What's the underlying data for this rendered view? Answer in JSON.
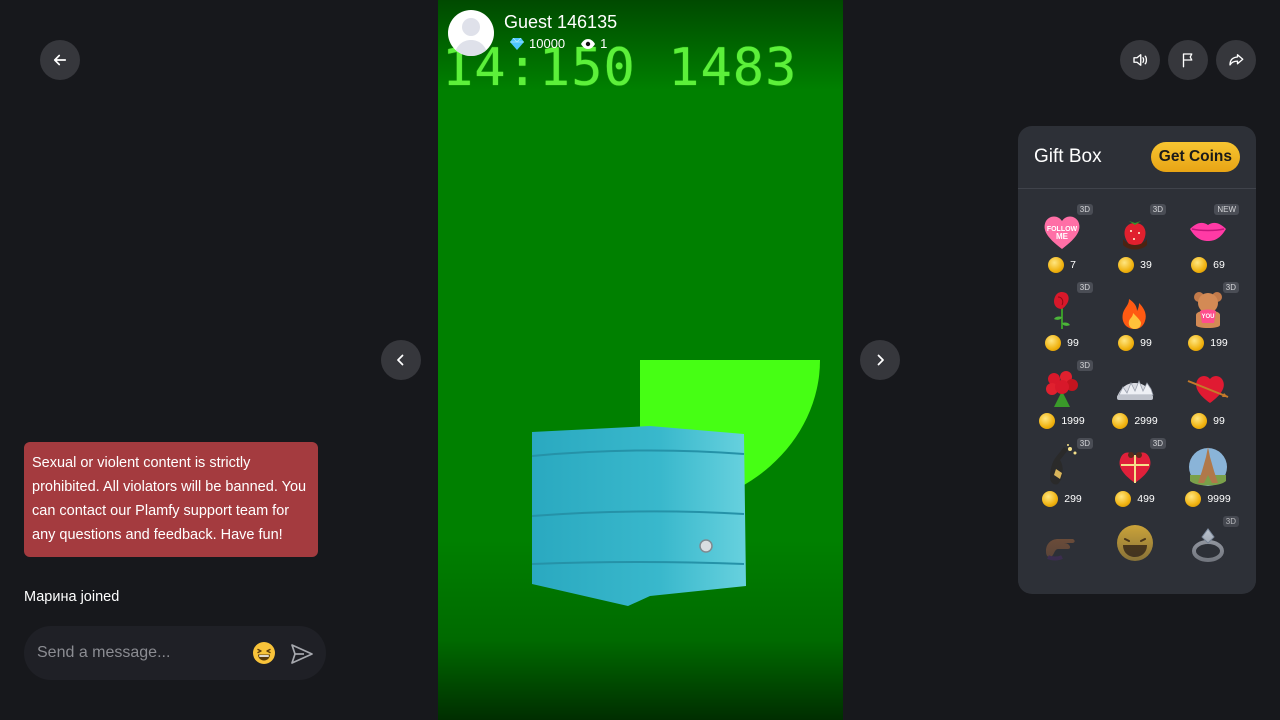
{
  "streamer": {
    "name": "Guest 146135",
    "diamonds": "10000",
    "viewers": "1"
  },
  "stream_overlay_text": "14:150 1483",
  "chat": {
    "notice": "Sexual or violent content is strictly prohibited. All violators will be banned. You can contact our Plamfy support team for any questions and feedback. Have fun!",
    "joined": "Марина joined",
    "placeholder": "Send a message..."
  },
  "gift_box": {
    "title": "Gift Box",
    "get_coins": "Get Coins",
    "gifts": [
      {
        "icon": "follow-me-heart-icon",
        "tag": "3D",
        "price": "7"
      },
      {
        "icon": "strawberry-icon",
        "tag": "3D",
        "price": "39"
      },
      {
        "icon": "lips-icon",
        "tag": "NEW",
        "price": "69"
      },
      {
        "icon": "rose-icon",
        "tag": "3D",
        "price": "99"
      },
      {
        "icon": "fire-icon",
        "tag": "",
        "price": "99"
      },
      {
        "icon": "teddy-bear-icon",
        "tag": "3D",
        "price": "199"
      },
      {
        "icon": "rose-bouquet-icon",
        "tag": "3D",
        "price": "1999"
      },
      {
        "icon": "tiara-icon",
        "tag": "",
        "price": "2999"
      },
      {
        "icon": "heart-arrow-icon",
        "tag": "",
        "price": "99"
      },
      {
        "icon": "champagne-icon",
        "tag": "3D",
        "price": "299"
      },
      {
        "icon": "heart-gift-box-icon",
        "tag": "3D",
        "price": "499"
      },
      {
        "icon": "eiffel-tower-icon",
        "tag": "",
        "price": "9999"
      },
      {
        "icon": "hand-icon",
        "tag": "",
        "price": ""
      },
      {
        "icon": "laughing-face-icon",
        "tag": "",
        "price": ""
      },
      {
        "icon": "ring-icon",
        "tag": "3D",
        "price": ""
      }
    ]
  },
  "colors": {
    "background": "#17181c",
    "notice": "#a43b3f",
    "coin": "#f0b20f",
    "stage_green": "#008000"
  }
}
